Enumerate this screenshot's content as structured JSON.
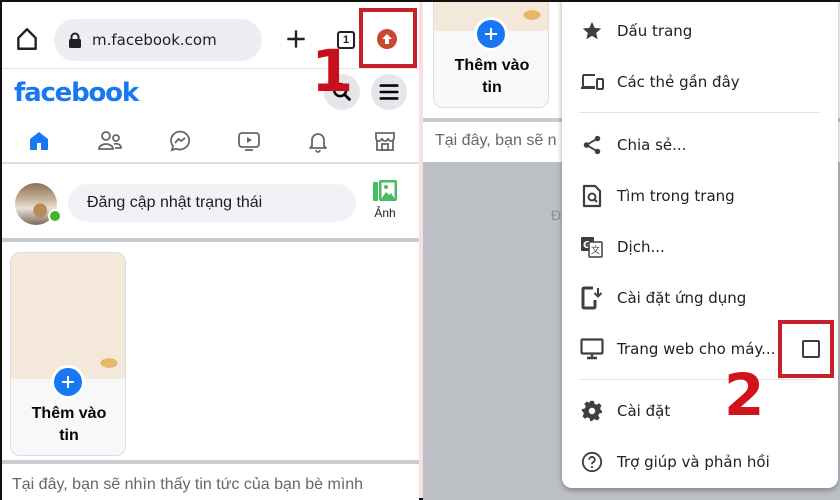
{
  "left_panel": {
    "browser": {
      "url": "m.facebook.com",
      "tab_count": "1",
      "annotation_step": "1"
    },
    "facebook": {
      "logo": "facebook",
      "nav_items": [
        "home",
        "friends",
        "messenger",
        "watch",
        "notifications",
        "marketplace"
      ],
      "composer_placeholder": "Đăng cập nhật trạng thái",
      "photo_label": "Ảnh",
      "story_label_line1": "Thêm vào",
      "story_label_line2": "tin",
      "feed_hint": "Tại đây, bạn sẽ nhìn thấy tin tức của bạn bè mình"
    }
  },
  "right_panel": {
    "story_label_line1": "Thêm vào",
    "story_label_line2": "tin",
    "feed_hint_truncated": "Tại đây, bạn sẽ n",
    "faded_letter": "Đ",
    "annotation_step": "2",
    "menu": {
      "items": [
        {
          "label": "Dấu trang",
          "icon": "star-icon"
        },
        {
          "label": "Các thẻ gần đây",
          "icon": "recent-tabs-icon"
        },
        {
          "label": "Chia sẻ...",
          "icon": "share-icon"
        },
        {
          "label": "Tìm trong trang",
          "icon": "find-in-page-icon"
        },
        {
          "label": "Dịch...",
          "icon": "translate-icon"
        },
        {
          "label": "Cài đặt ứng dụng",
          "icon": "install-app-icon"
        },
        {
          "label": "Trang web cho máy...",
          "icon": "desktop-icon",
          "checkbox_checked": false
        },
        {
          "label": "Cài đặt",
          "icon": "settings-icon"
        },
        {
          "label": "Trợ giúp và phản hồi",
          "icon": "help-icon"
        }
      ]
    }
  },
  "colors": {
    "facebook_blue": "#1877f2",
    "annotation_red": "#c8202a",
    "online_green": "#42b72a",
    "update_icon": "#c9482f"
  }
}
